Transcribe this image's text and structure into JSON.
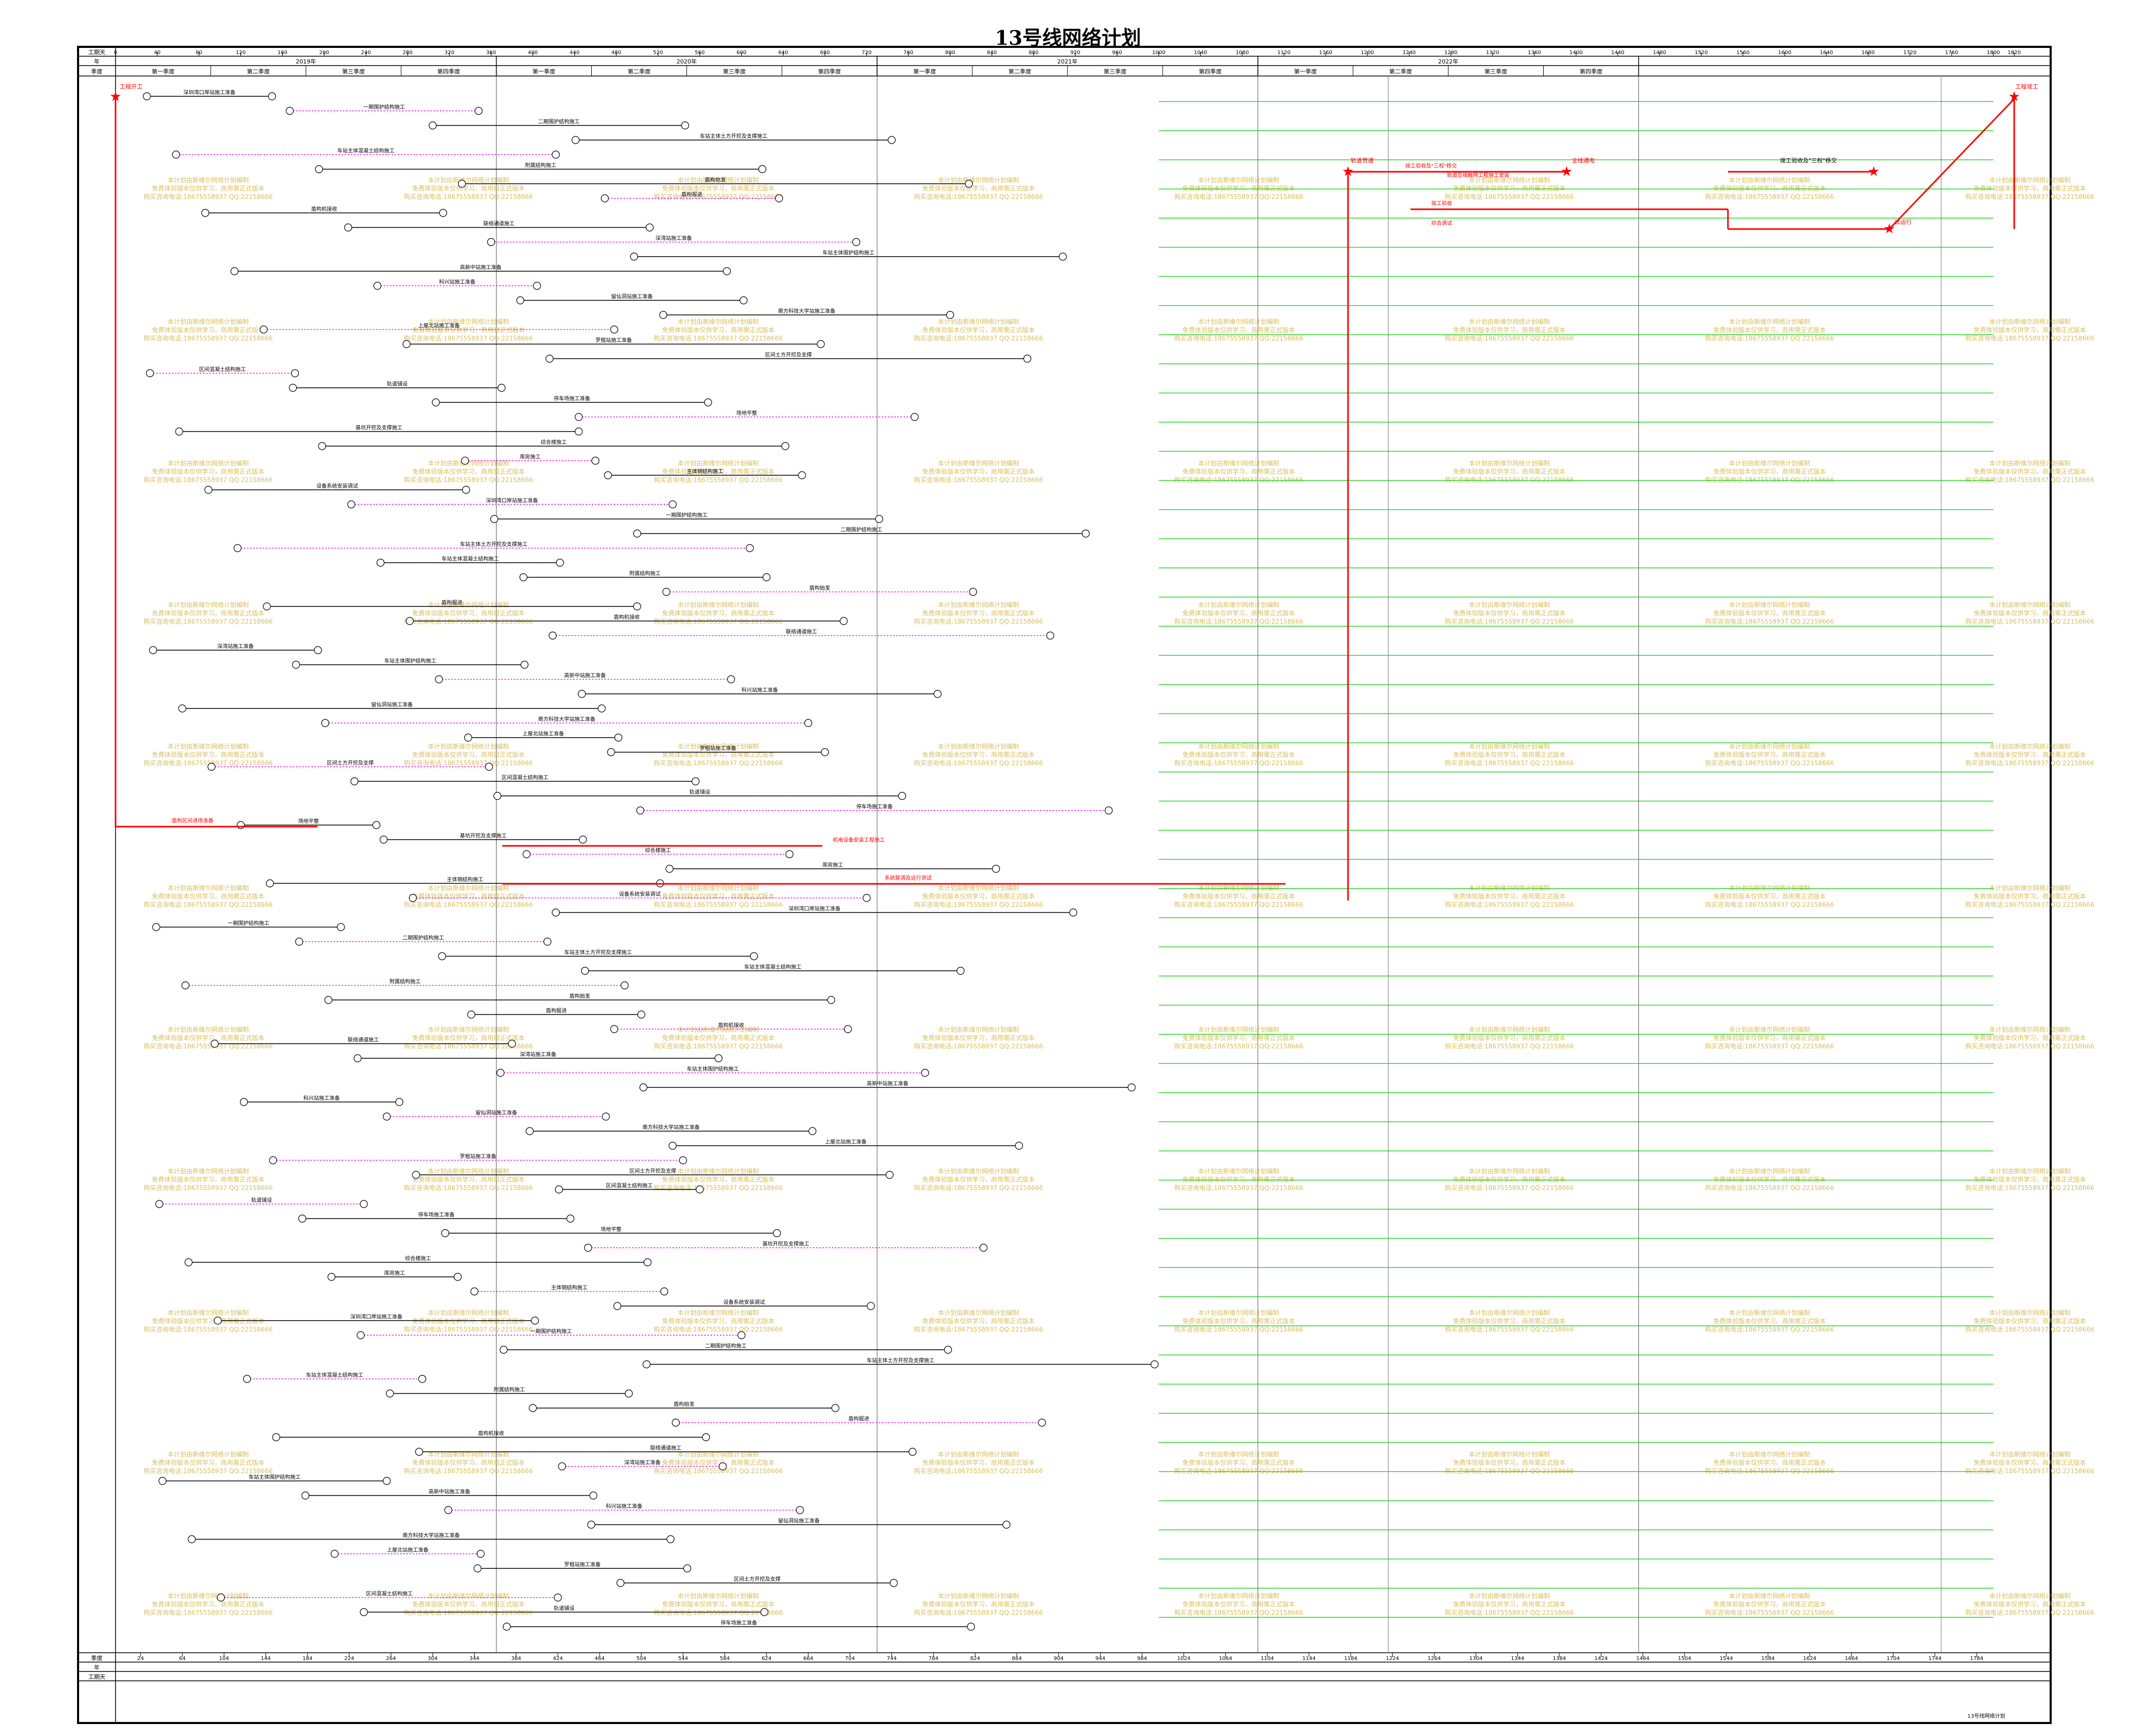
{
  "title": "13号线网络计划",
  "header_labels": {
    "scale": "工期天",
    "year": "年",
    "quarter": "季度"
  },
  "footer_labels": {
    "quarter": "季度",
    "year": "年",
    "scale": "工期天"
  },
  "years": [
    "2019年",
    "2020年",
    "2021年",
    "2022年"
  ],
  "quarters": [
    "第一季度",
    "第二季度",
    "第三季度",
    "第四季度"
  ],
  "top_ticks": [
    0,
    40,
    80,
    120,
    160,
    200,
    240,
    280,
    320,
    360,
    400,
    440,
    480,
    520,
    560,
    600,
    640,
    680,
    720,
    760,
    800,
    840,
    880,
    920,
    960,
    1000,
    1040,
    1080,
    1120,
    1160,
    1200,
    1240,
    1280,
    1320,
    1360,
    1400,
    1440,
    1480,
    1520,
    1560,
    1600,
    1640,
    1680,
    1720,
    1760,
    1800,
    1820
  ],
  "bottom_ticks": [
    24,
    64,
    104,
    144,
    184,
    224,
    264,
    304,
    344,
    384,
    424,
    464,
    504,
    544,
    584,
    624,
    664,
    704,
    744,
    784,
    824,
    864,
    904,
    944,
    984,
    1024,
    1064,
    1104,
    1144,
    1184,
    1224,
    1264,
    1304,
    1344,
    1384,
    1424,
    1464,
    1504,
    1544,
    1584,
    1624,
    1664,
    1704,
    1744,
    1784
  ],
  "milestones": {
    "start": "工程开工",
    "finish": "工程竣工",
    "track_through": "轨道贯通",
    "traction_power": "全线通电",
    "completion_acceptance": "竣工验收及\"三权\"移交",
    "trial_run": "试运行"
  },
  "critical_tasks": [
    "竣工验收及\"三权\"移交",
    "竣工验收",
    "综合调试",
    "轨道及接触网工程施工安装",
    "机电设备安装工程施工",
    "系统联调及运行测试",
    "盾构区间进场准备"
  ],
  "tasks": [
    "深圳湾口岸站施工准备",
    "一期围护结构施工",
    "二期围护结构施工",
    "车站主体土方开挖及支撑施工",
    "车站主体混凝土结构施工",
    "附属结构施工",
    "盾构始发",
    "盾构掘进",
    "盾构机接收",
    "联络通道施工",
    "深湾站施工准备",
    "车站主体围护结构施工",
    "高新中站施工准备",
    "科兴站施工准备",
    "留仙洞站施工准备",
    "南方科技大学站施工准备",
    "上屋北站施工准备",
    "罗租站施工准备",
    "区间土方开挖及支撑",
    "区间混凝土结构施工",
    "轨道铺设",
    "停车场施工准备",
    "场地平整",
    "基坑开挖及支撑施工",
    "综合楼施工",
    "库房施工",
    "主体钢结构施工",
    "设备系统安装调试"
  ],
  "watermark_lines": [
    "本计划由斯维尔网络计划编制",
    "免费体验版本仅供学习，商用需正式版本",
    "购买咨询电话:18675558937 QQ:22158666"
  ],
  "footer_notes": "13号线网络计划",
  "colors": {
    "critical": "#ff0000",
    "normal": "#000000",
    "free_float": "#00cc00",
    "dummy": "#ff00ff",
    "watermark": "#d4b84a",
    "grid": "#000000"
  }
}
